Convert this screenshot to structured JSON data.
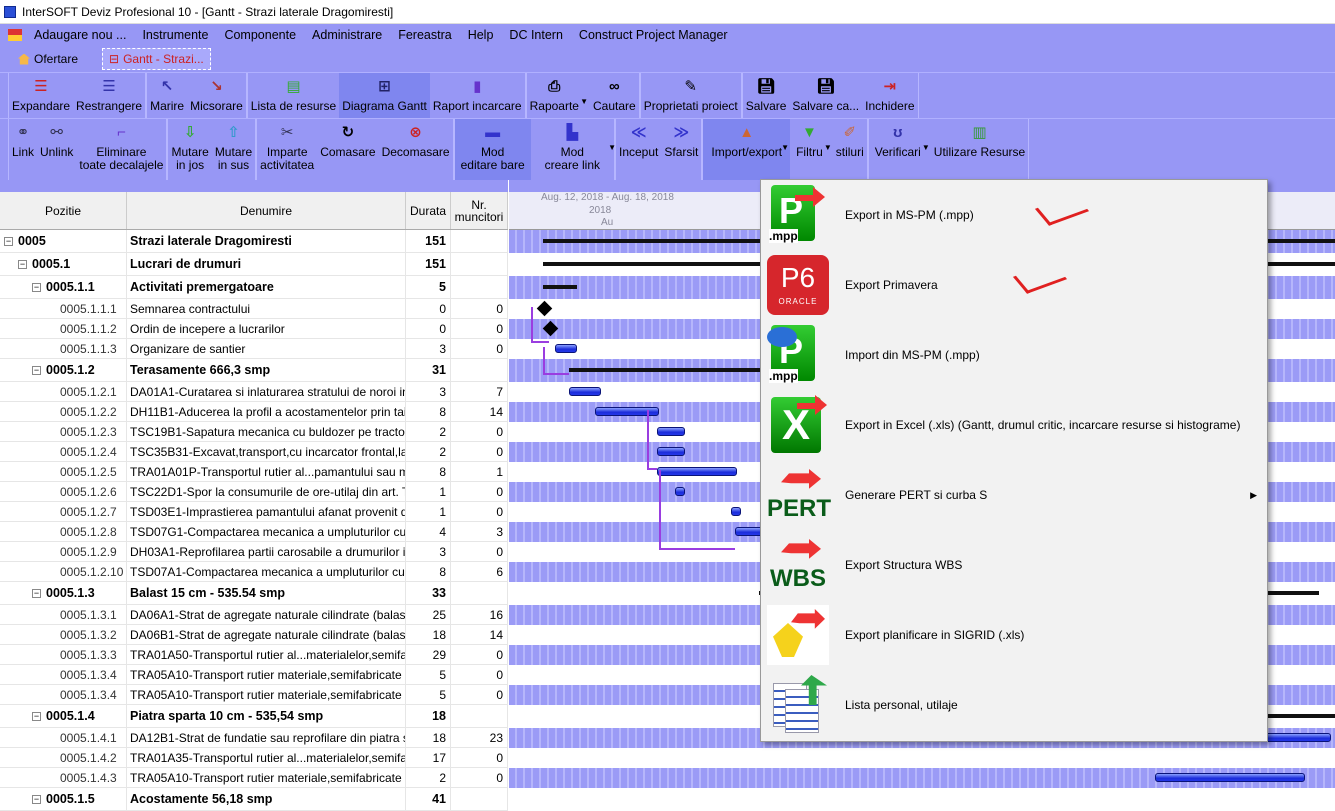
{
  "window": {
    "title": "InterSOFT Deviz Profesional 10 - [Gantt - Strazi laterale Dragomiresti]"
  },
  "menubar": [
    "Adaugare nou ...",
    "Instrumente",
    "Componente",
    "Administrare",
    "Fereastra",
    "Help",
    "DC Intern",
    "Construct Project Manager"
  ],
  "doc_tabs": {
    "home": "Ofertare",
    "active": "Gantt - Strazi..."
  },
  "toolbar1": [
    {
      "label": "Expandare",
      "icon": "expand-icon"
    },
    {
      "label": "Restrangere",
      "icon": "collapse-icon"
    },
    {
      "label": "Marire",
      "icon": "zoom-in-icon"
    },
    {
      "label": "Micsorare",
      "icon": "zoom-out-icon"
    },
    {
      "label": "Lista de resurse",
      "icon": "resource-list-icon"
    },
    {
      "label": "Diagrama Gantt",
      "icon": "gantt-icon"
    },
    {
      "label": "Raport incarcare",
      "icon": "load-report-icon"
    },
    {
      "label": "Rapoarte",
      "icon": "printer-icon"
    },
    {
      "label": "Cautare",
      "icon": "binoculars-icon"
    },
    {
      "label": "Proprietati proiect",
      "icon": "properties-icon"
    },
    {
      "label": "Salvare",
      "icon": "save-icon"
    },
    {
      "label": "Salvare ca...",
      "icon": "save-as-icon"
    },
    {
      "label": "Inchidere",
      "icon": "close-icon"
    }
  ],
  "toolbar2": [
    {
      "label": "Link",
      "icon": "link-icon"
    },
    {
      "label": "Unlink",
      "icon": "unlink-icon"
    },
    {
      "label": "Eliminare\ntoate decalajele",
      "icon": "remove-lags-icon"
    },
    {
      "label": "Mutare\nin jos",
      "icon": "move-down-icon"
    },
    {
      "label": "Mutare\nin sus",
      "icon": "move-up-icon"
    },
    {
      "label": "Imparte\nactivitatea",
      "icon": "split-icon"
    },
    {
      "label": "Comasare",
      "icon": "merge-icon"
    },
    {
      "label": "Decomasare",
      "icon": "unmerge-icon"
    },
    {
      "label": "Mod\neditare bare",
      "icon": "edit-bars-icon"
    },
    {
      "label": "Mod\ncreare link",
      "icon": "create-link-icon"
    },
    {
      "label": "Inceput",
      "icon": "go-start-icon"
    },
    {
      "label": "Sfarsit",
      "icon": "go-end-icon"
    },
    {
      "label": "Import/export",
      "icon": "import-export-icon"
    },
    {
      "label": "Filtru",
      "icon": "filter-icon"
    },
    {
      "label": "stiluri",
      "icon": "styles-icon"
    },
    {
      "label": "Verificari",
      "icon": "stethoscope-icon"
    },
    {
      "label": "Utilizare Resurse",
      "icon": "resource-usage-icon"
    }
  ],
  "grid": {
    "headers": {
      "pozitie": "Pozitie",
      "denumire": "Denumire",
      "durata": "Durata",
      "muncitori": "Nr.\nmuncitori"
    },
    "rows": [
      {
        "level": 0,
        "pos": "0005",
        "name": "Strazi laterale Dragomiresti",
        "dur": "151",
        "nr": ""
      },
      {
        "level": 1,
        "pos": "0005.1",
        "name": "Lucrari de drumuri",
        "dur": "151",
        "nr": ""
      },
      {
        "level": 2,
        "pos": "0005.1.1",
        "name": "Activitati premergatoare",
        "dur": "5",
        "nr": ""
      },
      {
        "level": 3,
        "pos": "0005.1.1.1",
        "name": "Semnarea contractului",
        "dur": "0",
        "nr": "0"
      },
      {
        "level": 3,
        "pos": "0005.1.1.2",
        "name": "Ordin de incepere a lucrarilor",
        "dur": "0",
        "nr": "0"
      },
      {
        "level": 3,
        "pos": "0005.1.1.3",
        "name": "Organizare de santier",
        "dur": "3",
        "nr": "0"
      },
      {
        "level": 2,
        "pos": "0005.1.2",
        "name": "Terasamente 666,3 smp",
        "dur": "31",
        "nr": ""
      },
      {
        "level": 3,
        "pos": "0005.1.2.1",
        "name": "DA01A1-Curatarea si inlaturarea stratului de noroi in...",
        "dur": "3",
        "nr": "7"
      },
      {
        "level": 3,
        "pos": "0005.1.2.2",
        "name": "DH11B1-Aducerea la profil a acostamentelor prin tai...",
        "dur": "8",
        "nr": "14"
      },
      {
        "level": 3,
        "pos": "0005.1.2.3",
        "name": "TSC19B1-Sapatura mecanica cu buldozer pe tractor...",
        "dur": "2",
        "nr": "0"
      },
      {
        "level": 3,
        "pos": "0005.1.2.4",
        "name": "TSC35B31-Excavat,transport,cu incarcator frontal,la...",
        "dur": "2",
        "nr": "0"
      },
      {
        "level": 3,
        "pos": "0005.1.2.5",
        "name": "TRA01A01P-Transportul rutier al...pamantului sau m...",
        "dur": "8",
        "nr": "1"
      },
      {
        "level": 3,
        "pos": "0005.1.2.6",
        "name": "TSC22D1-Spor la consumurile de ore-utilaj din art. T...",
        "dur": "1",
        "nr": "0"
      },
      {
        "level": 3,
        "pos": "0005.1.2.7",
        "name": "TSD03E1-Imprastierea pamantului afanat provenit di...",
        "dur": "1",
        "nr": "0"
      },
      {
        "level": 3,
        "pos": "0005.1.2.8",
        "name": "TSD07G1-Compactarea mecanica a umpluturilor cu...",
        "dur": "4",
        "nr": "3"
      },
      {
        "level": 3,
        "pos": "0005.1.2.9",
        "name": "DH03A1-Reprofilarea partii carosabile a drumurilor i...",
        "dur": "3",
        "nr": "0"
      },
      {
        "level": 3,
        "pos": "0005.1.2.10",
        "name": "TSD07A1-Compactarea mecanica a umpluturilor cu r...",
        "dur": "8",
        "nr": "6"
      },
      {
        "level": 2,
        "pos": "0005.1.3",
        "name": "Balast 15 cm - 535.54 smp",
        "dur": "33",
        "nr": ""
      },
      {
        "level": 3,
        "pos": "0005.1.3.1",
        "name": "DA06A1-Strat de agregate naturale cilindrate (balast)...",
        "dur": "25",
        "nr": "16"
      },
      {
        "level": 3,
        "pos": "0005.1.3.2",
        "name": "DA06B1-Strat de agregate naturale cilindrate (balast)...",
        "dur": "18",
        "nr": "14"
      },
      {
        "level": 3,
        "pos": "0005.1.3.3",
        "name": "TRA01A50-Transportul rutier al...materialelor,semifa...",
        "dur": "29",
        "nr": "0"
      },
      {
        "level": 3,
        "pos": "0005.1.3.4",
        "name": "TRA05A10-Transport rutier materiale,semifabricate c...",
        "dur": "5",
        "nr": "0"
      },
      {
        "level": 3,
        "pos": "0005.1.3.4",
        "name": "TRA05A10-Transport rutier materiale,semifabricate c...",
        "dur": "5",
        "nr": "0"
      },
      {
        "level": 2,
        "pos": "0005.1.4",
        "name": "Piatra sparta 10 cm - 535,54 smp",
        "dur": "18",
        "nr": ""
      },
      {
        "level": 3,
        "pos": "0005.1.4.1",
        "name": "DA12B1-Strat de fundatie sau reprofilare din piatra s...",
        "dur": "18",
        "nr": "23"
      },
      {
        "level": 3,
        "pos": "0005.1.4.2",
        "name": "TRA01A35-Transportul rutier al...materialelor,semifa...",
        "dur": "17",
        "nr": "0"
      },
      {
        "level": 3,
        "pos": "0005.1.4.3",
        "name": "TRA05A10-Transport rutier materiale,semifabricate c...",
        "dur": "2",
        "nr": "0"
      },
      {
        "level": 2,
        "pos": "0005.1.5",
        "name": "Acostamente 56,18 smp",
        "dur": "41",
        "nr": ""
      }
    ]
  },
  "gantt": {
    "timescale_top": "Aug. 12, 2018 - Aug. 18, 2018",
    "timescale_mid": "2018",
    "timescale_bottom": "Au"
  },
  "context_menu": [
    {
      "label": "Export in MS-PM (.mpp)",
      "icon": "mpp-export-icon",
      "checked": true
    },
    {
      "label": "Export Primavera",
      "icon": "primavera-p6-icon",
      "checked": true
    },
    {
      "label": "Import din MS-PM (.mpp)",
      "icon": "mpp-import-icon",
      "checked": false
    },
    {
      "label": "Export in Excel (.xls) (Gantt, drumul critic, incarcare resurse si histograme)",
      "icon": "excel-export-icon",
      "checked": false
    },
    {
      "label": "Generare PERT si curba S",
      "icon": "pert-icon",
      "checked": false,
      "submenu": true
    },
    {
      "label": "Export Structura WBS",
      "icon": "wbs-icon",
      "checked": false
    },
    {
      "label": "Export planificare in SIGRID (.xls)",
      "icon": "sigrid-icon",
      "checked": false
    },
    {
      "label": "Lista personal, utilaje",
      "icon": "document-list-icon",
      "checked": false
    }
  ],
  "icon_text": {
    "mpp": ".mpp",
    "p6": "P6",
    "oracle": "ORACLE",
    "pert": "PERT",
    "wbs": "WBS",
    "x": "X",
    "p": "P"
  }
}
